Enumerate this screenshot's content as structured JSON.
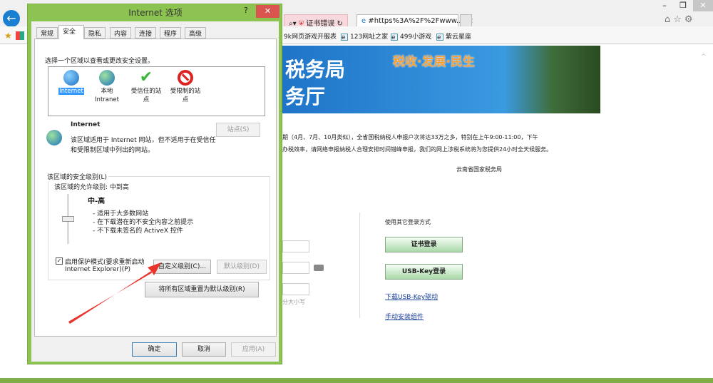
{
  "browser": {
    "tabs": [
      {
        "label": "证书错误"
      },
      {
        "label": "#https%3A%2F%2Fwww...."
      }
    ],
    "favorites": [
      "9k网页游戏开服表",
      "123网址之家",
      "499小游戏",
      "紫云星座"
    ],
    "window_controls": {
      "minimize": "–",
      "restore": "❐",
      "close": "✕"
    },
    "toolbar_icons": {
      "home": "⌂",
      "star": "☆",
      "gear": "⚙"
    }
  },
  "page": {
    "banner_line1": "税务局",
    "banner_line2": "务厅",
    "slogan": "税收·发展·民生",
    "notice_line1": "期（4月、7月、10月类似），全省国税纳税人申报户次将达33万之多，特别在上午9:00-11:00，下午",
    "notice_line2": "办税效率，请网络申报纳税人合理安排时间错峰申报，我们的网上涉税系统将为您提供24小时全天候服务。",
    "signature": "云南省国家税务局",
    "other_login_label": "使用其它登录方式",
    "cert_login": "证书登录",
    "usbkey_login": "USB-Key登录",
    "download_driver": "下载USB-Key驱动",
    "install_component": "手动安装组件",
    "case_hint": "分大小写"
  },
  "dialog": {
    "title": "Internet 选项",
    "help": "?",
    "close": "✕",
    "tabs": [
      "常规",
      "安全",
      "隐私",
      "内容",
      "连接",
      "程序",
      "高级"
    ],
    "active_tab": "安全",
    "zone_prompt": "选择一个区域以查看或更改安全设置。",
    "zones": [
      {
        "line1": "Internet",
        "line2": ""
      },
      {
        "line1": "本地",
        "line2": "Intranet"
      },
      {
        "line1": "受信任的站",
        "line2": "点"
      },
      {
        "line1": "受限制的站",
        "line2": "点"
      }
    ],
    "zone_name": "Internet",
    "zone_desc1": "该区域适用于 Internet 网站，但不适用于在受信任",
    "zone_desc2": "和受限制区域中列出的网站。",
    "sites_button": "站点(S)",
    "level_group": "该区域的安全级别(L)",
    "allowed_levels": "该区域的允许级别: 中到高",
    "level_name": "中-高",
    "level_points": [
      "- 适用于大多数网站",
      "- 在下载潜在的不安全内容之前提示",
      "- 不下载未签名的 ActiveX 控件"
    ],
    "slider_level": 0.5,
    "protected_mode_line1": "启用保护模式(要求重新启动",
    "protected_mode_line2": "Internet Explorer)(P)",
    "protected_mode_checked": true,
    "custom_level": "自定义级别(C)...",
    "default_level": "默认级别(D)",
    "reset_all": "将所有区域重置为默认级别(R)",
    "ok": "确定",
    "cancel": "取消",
    "apply": "应用(A)"
  },
  "colors": {
    "dialog_frame": "#8dc351",
    "arrow": "#e8342a"
  }
}
